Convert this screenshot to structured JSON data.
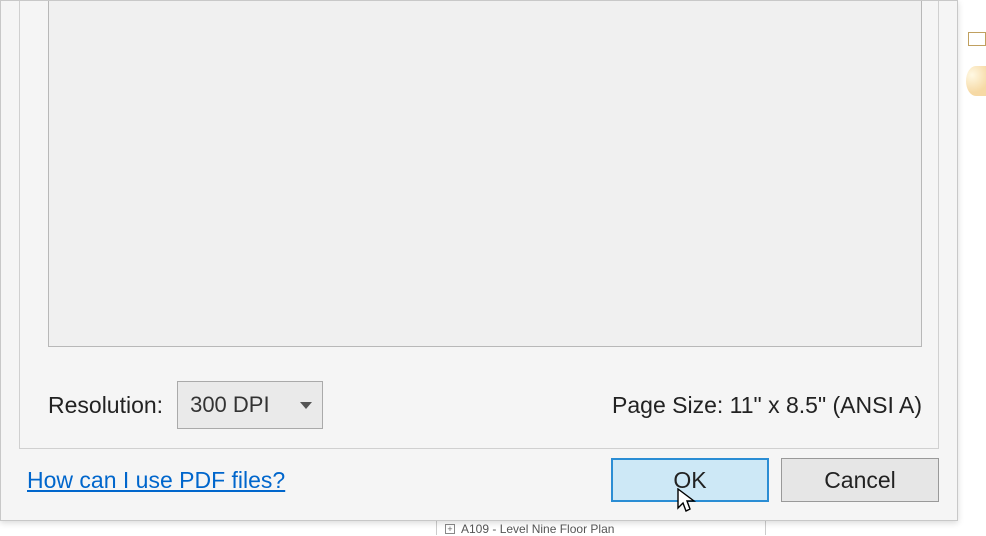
{
  "options": {
    "resolution_label": "Resolution:",
    "resolution_value": "300 DPI",
    "page_size_text": "Page Size: 11\" x 8.5\" (ANSI A)"
  },
  "footer": {
    "help_link": "How can I use PDF files?",
    "ok_label": "OK",
    "cancel_label": "Cancel"
  },
  "background": {
    "tree_item": "A109 - Level  Nine Floor Plan"
  }
}
